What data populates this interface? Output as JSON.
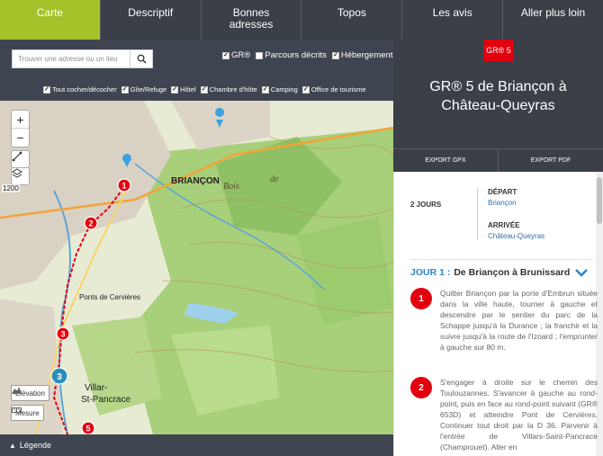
{
  "nav": {
    "tabs": [
      {
        "label": "Carte",
        "active": true
      },
      {
        "label": "Descriptif",
        "active": false
      },
      {
        "label": "Bonnes adresses",
        "active": false
      },
      {
        "label": "Topos",
        "active": false
      },
      {
        "label": "Les avis",
        "active": false
      },
      {
        "label": "Aller plus loin",
        "active": false
      }
    ]
  },
  "map": {
    "search_placeholder": "Trouver une adresse ou un lieu",
    "search_icon": "search-icon",
    "filters_top": [
      {
        "label": "GR®",
        "checked": true
      },
      {
        "label": "Parcours décrits",
        "checked": false
      },
      {
        "label": "Hébergements",
        "checked": true
      }
    ],
    "filters_lodging": [
      {
        "label": "Tout cocher/décocher",
        "checked": true
      },
      {
        "label": "Gîte/Refuge",
        "checked": true
      },
      {
        "label": "Hôtel",
        "checked": true
      },
      {
        "label": "Chambre d'hôte",
        "checked": true
      },
      {
        "label": "Camping",
        "checked": true
      },
      {
        "label": "Office de tourisme",
        "checked": true
      }
    ],
    "scale": "1200",
    "labels": [
      "BRIANÇON",
      "Bois",
      "de",
      "Villar-",
      "St-Pancrace",
      "Ponts de Cervières"
    ],
    "markers": [
      "1",
      "2",
      "3",
      "3",
      "5"
    ],
    "elevation_label": "Elévation",
    "measure_label": "Mesure",
    "legend_label": "Légende",
    "colors": {
      "forest": "#a8cf7a",
      "urban": "#d9d2c4",
      "river": "#5aa6d6",
      "route": "#e3000f"
    }
  },
  "route": {
    "badge": "GR® 5",
    "title_line1": "GR® 5 de Briançon à",
    "title_line2": "Château-Queyras",
    "export_gpx": "EXPORT GPX",
    "export_pdf": "EXPORT PDF",
    "duration": "2 JOURS",
    "depart_label": "DÉPART",
    "depart_value": "Briançon",
    "arrivee_label": "ARRIVÉE",
    "arrivee_value": "Château-Queyras",
    "day_prefix": "JOUR 1 :",
    "day_title": "De Briançon à Brunissard",
    "steps": [
      {
        "num": "1",
        "text": "Quitter Briançon par la porte d'Embrun située dans la ville haute, tourner à gauche et descendre par le sentier du parc de la Schappe jusqu'à la Durance ; la franchir et la suivre jusqu'à la route de l'Izoard ; l'emprunter à gauche sur 80 m."
      },
      {
        "num": "2",
        "text": "S'engager à droite sur le chemin des Toulouzannes. S'avancer à gauche au rond-point, puis en face au rond-point suivant (GR® 653D) et atteindre Pont de Cervières. Continuer tout droit par la D 36. Parvenir à l'entrée de Villars-Saint-Pancrace (Champrouet). Aller en"
      }
    ],
    "accent": "#e3000f",
    "link_color": "#2b6ea8"
  }
}
